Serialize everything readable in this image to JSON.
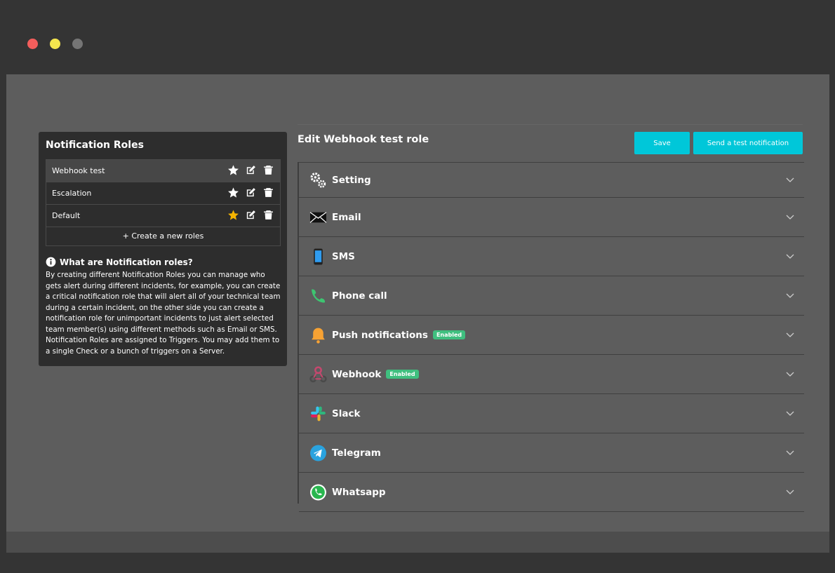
{
  "window_controls": {
    "close": "close",
    "minimize": "minimize",
    "maximize": "maximize"
  },
  "sidebar": {
    "title": "Notification Roles",
    "roles": [
      {
        "name": "Webhook test",
        "starred": false
      },
      {
        "name": "Escalation",
        "starred": false
      },
      {
        "name": "Default",
        "starred": true
      }
    ],
    "create_label": "Create a new roles",
    "info_title": "What are Notification roles?",
    "info_body": "By creating different Notification Roles you can manage who gets alert during different incidents, for example, you can create a critical notification role that will alert all of your technical team during a certain incident, on the other side you can create a notification role for unimportant incidents to just alert selected team member(s) using different methods such as Email or SMS. Notification Roles are assigned to Triggers. You may add them to a single Check or a bunch of triggers on a Server."
  },
  "main": {
    "title": "Edit Webhook test role",
    "save_label": "Save",
    "test_label": "Send a test notification",
    "sections": [
      {
        "label": "Setting",
        "icon": "gears-icon",
        "badge": ""
      },
      {
        "label": "Email",
        "icon": "envelope-icon",
        "badge": ""
      },
      {
        "label": "SMS",
        "icon": "phone-device-icon",
        "badge": ""
      },
      {
        "label": "Phone call",
        "icon": "phone-call-icon",
        "badge": ""
      },
      {
        "label": "Push notifications",
        "icon": "bell-icon",
        "badge": "Enabled"
      },
      {
        "label": "Webhook",
        "icon": "webhook-icon",
        "badge": "Enabled"
      },
      {
        "label": "Slack",
        "icon": "slack-icon",
        "badge": ""
      },
      {
        "label": "Telegram",
        "icon": "telegram-icon",
        "badge": ""
      },
      {
        "label": "Whatsapp",
        "icon": "whatsapp-icon",
        "badge": ""
      }
    ]
  },
  "colors": {
    "accent": "#00c7d9",
    "badge": "#3fbf7f",
    "star_active": "#f5b400"
  }
}
